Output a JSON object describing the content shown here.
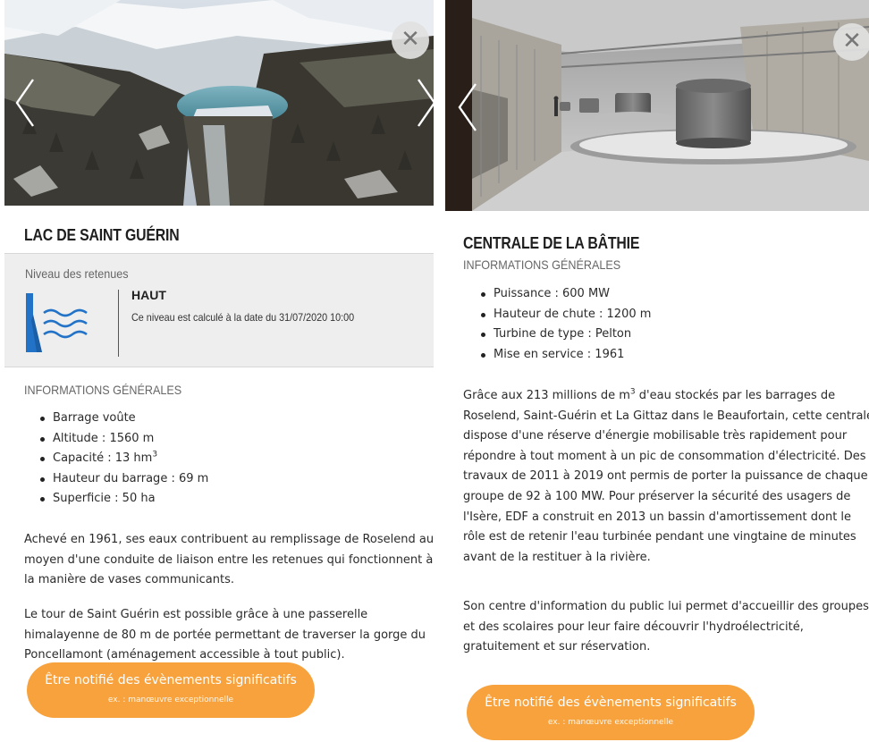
{
  "colors": {
    "accent_orange": "#f7a23c",
    "level_icon_blue": "#2273c8",
    "panel_gray": "#eeeeee"
  },
  "cards": [
    {
      "title": "LAC DE SAINT GUÉRIN",
      "level_box": {
        "label": "Niveau des retenues",
        "value": "HAUT",
        "note": "Ce niveau est calculé à la date du 31/07/2020 10:00"
      },
      "section_title": "INFORMATIONS GÉNÉRALES",
      "facts": [
        "Barrage voûte",
        "Altitude : 1560 m",
        "Hauteur du barrage : 69 m",
        "Superficie : 50 ha"
      ],
      "capacity_fact": {
        "label": "Capacité : 13 hm",
        "sup": "3"
      },
      "description": [
        [
          "Achevé en 1961, ses eaux contribuent au remplissage de Roselend au",
          "moyen d'une conduite de liaison entre les retenues qui fonctionnent à",
          "la manière de vases communicants."
        ],
        [
          "Le tour de Saint Guérin est possible grâce à une passerelle",
          "himalayenne de 80 m de portée permettant de traverser la gorge du",
          "Poncellamont (aménagement accessible à tout public)."
        ]
      ],
      "notify_button": {
        "label": "Être notifié des évènements significatifs",
        "sublabel": "ex. : manœuvre exceptionnelle"
      },
      "icons": {
        "close": "close-icon",
        "prev": "chevron-left-icon",
        "next": "chevron-right-icon",
        "level": "water-level-high-icon"
      }
    },
    {
      "title": "CENTRALE DE LA BÂTHIE",
      "section_title": "INFORMATIONS GÉNÉRALES",
      "facts": [
        "Puissance : 600 MW",
        "Hauteur de chute : 1200 m",
        "Turbine de type : Pelton",
        "Mise en service : 1961"
      ],
      "description_first_line": {
        "before": "Grâce aux 213 millions de m",
        "sup": "3",
        "after": " d'eau stockés par les barrages de"
      },
      "description": [
        [
          "Roselend, Saint-Guérin et La Gittaz dans le Beaufortain, cette centrale",
          "dispose d'une réserve d'énergie mobilisable très rapidement pour",
          "répondre à tout moment à un pic de consommation d'électricité. Des",
          "travaux de 2011 à 2019 ont permis de porter la puissance de chaque",
          "groupe de 92 à 100 MW. Pour préserver la sécurité des usagers de",
          "l'Isère, EDF a construit en 2013 un bassin d'amortissement dont le",
          "rôle est de retenir l'eau turbinée pendant une vingtaine de minutes",
          "avant de la restituer à la rivière."
        ],
        [
          "Son centre d'information du public lui permet d'accueillir des groupes",
          "et des scolaires pour leur faire découvrir l'hydroélectricité,",
          "gratuitement et sur réservation."
        ]
      ],
      "notify_button": {
        "label": "Être notifié des évènements significatifs",
        "sublabel": "ex. : manœuvre exceptionnelle"
      },
      "icons": {
        "close": "close-icon",
        "prev": "chevron-left-icon",
        "next": "chevron-right-icon"
      }
    }
  ]
}
